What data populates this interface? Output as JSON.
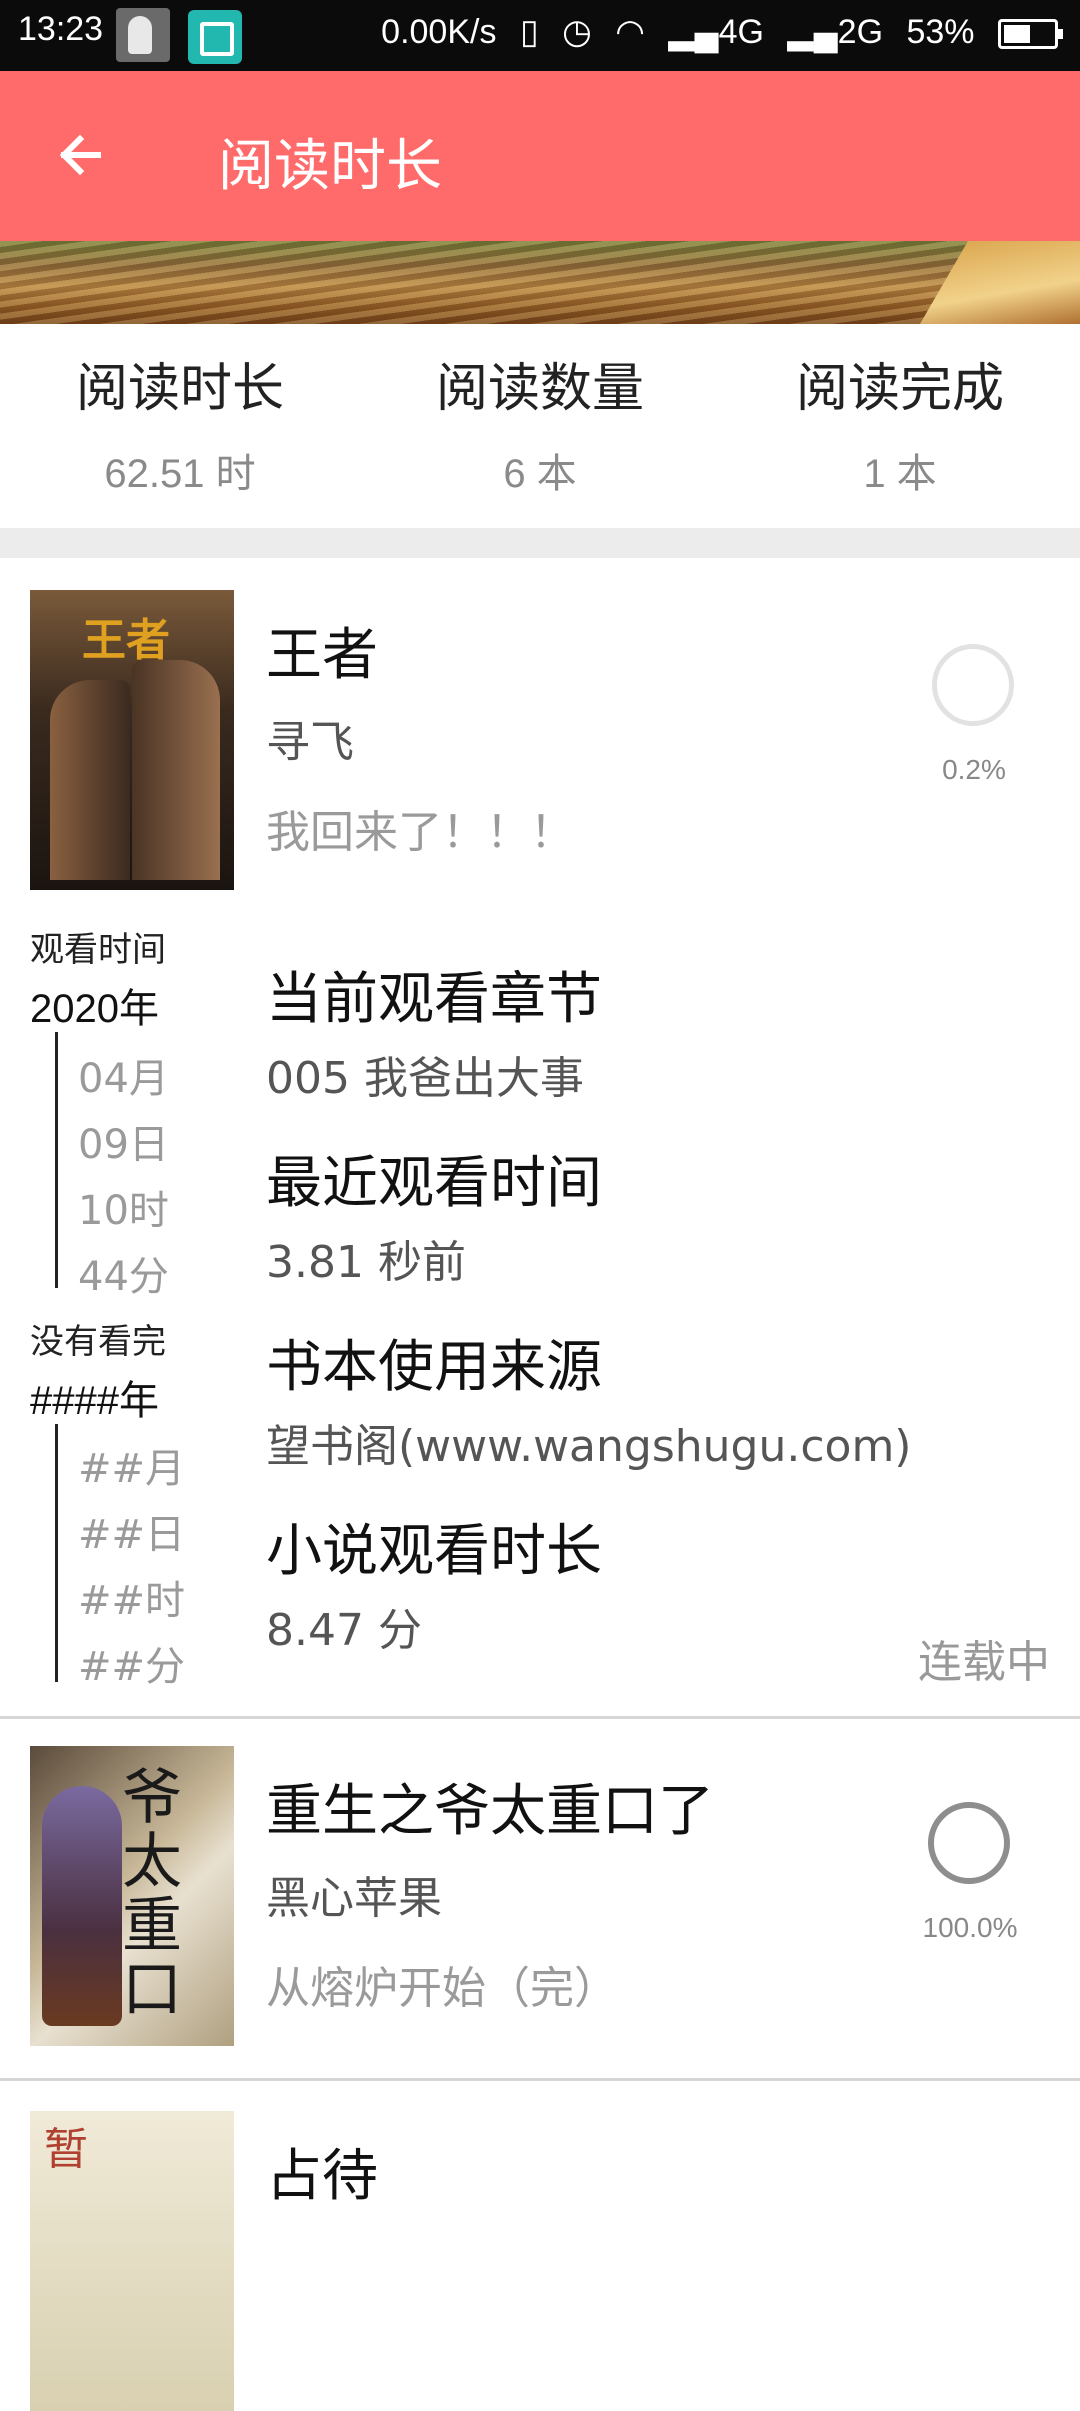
{
  "status_bar": {
    "time": "13:23",
    "speed": "0.00K/s",
    "network1": "4G",
    "network2": "2G",
    "battery": "53%"
  },
  "app_bar": {
    "title": "阅读时长",
    "back_icon": "arrow-left-icon"
  },
  "stats": [
    {
      "label": "阅读时长",
      "value": "62.51 时"
    },
    {
      "label": "阅读数量",
      "value": "6 本"
    },
    {
      "label": "阅读完成",
      "value": "1 本"
    }
  ],
  "books": [
    {
      "title": "王者",
      "author": "寻飞",
      "chapter": "我回来了！！！",
      "progress": "0.2%",
      "cover_text": "王者",
      "side": {
        "watch_label": "观看时间",
        "watch_year": "2020年",
        "watch_parts": [
          "04月",
          "09日",
          "10时",
          "44分"
        ],
        "finish_label": "没有看完",
        "finish_year": "####年",
        "finish_parts": [
          "##月",
          "##日",
          "##时",
          "##分"
        ]
      },
      "details": [
        {
          "label": "当前观看章节",
          "value": "005 我爸出大事"
        },
        {
          "label": "最近观看时间",
          "value": "3.81 秒前"
        },
        {
          "label": "书本使用来源",
          "value": "望书阁(www.wangshugu.com)"
        },
        {
          "label": "小说观看时长",
          "value": "8.47 分"
        }
      ],
      "status": "连载中"
    },
    {
      "title": "重生之爷太重口了",
      "author": "黑心苹果",
      "chapter": "从熔炉开始（完）",
      "progress": "100.0%",
      "cover_text": "爷太重口"
    },
    {
      "title": "占待",
      "cover_text": "暂"
    }
  ],
  "colors": {
    "accent": "#ff6b6b",
    "status_bar": "#0b0b0b"
  }
}
